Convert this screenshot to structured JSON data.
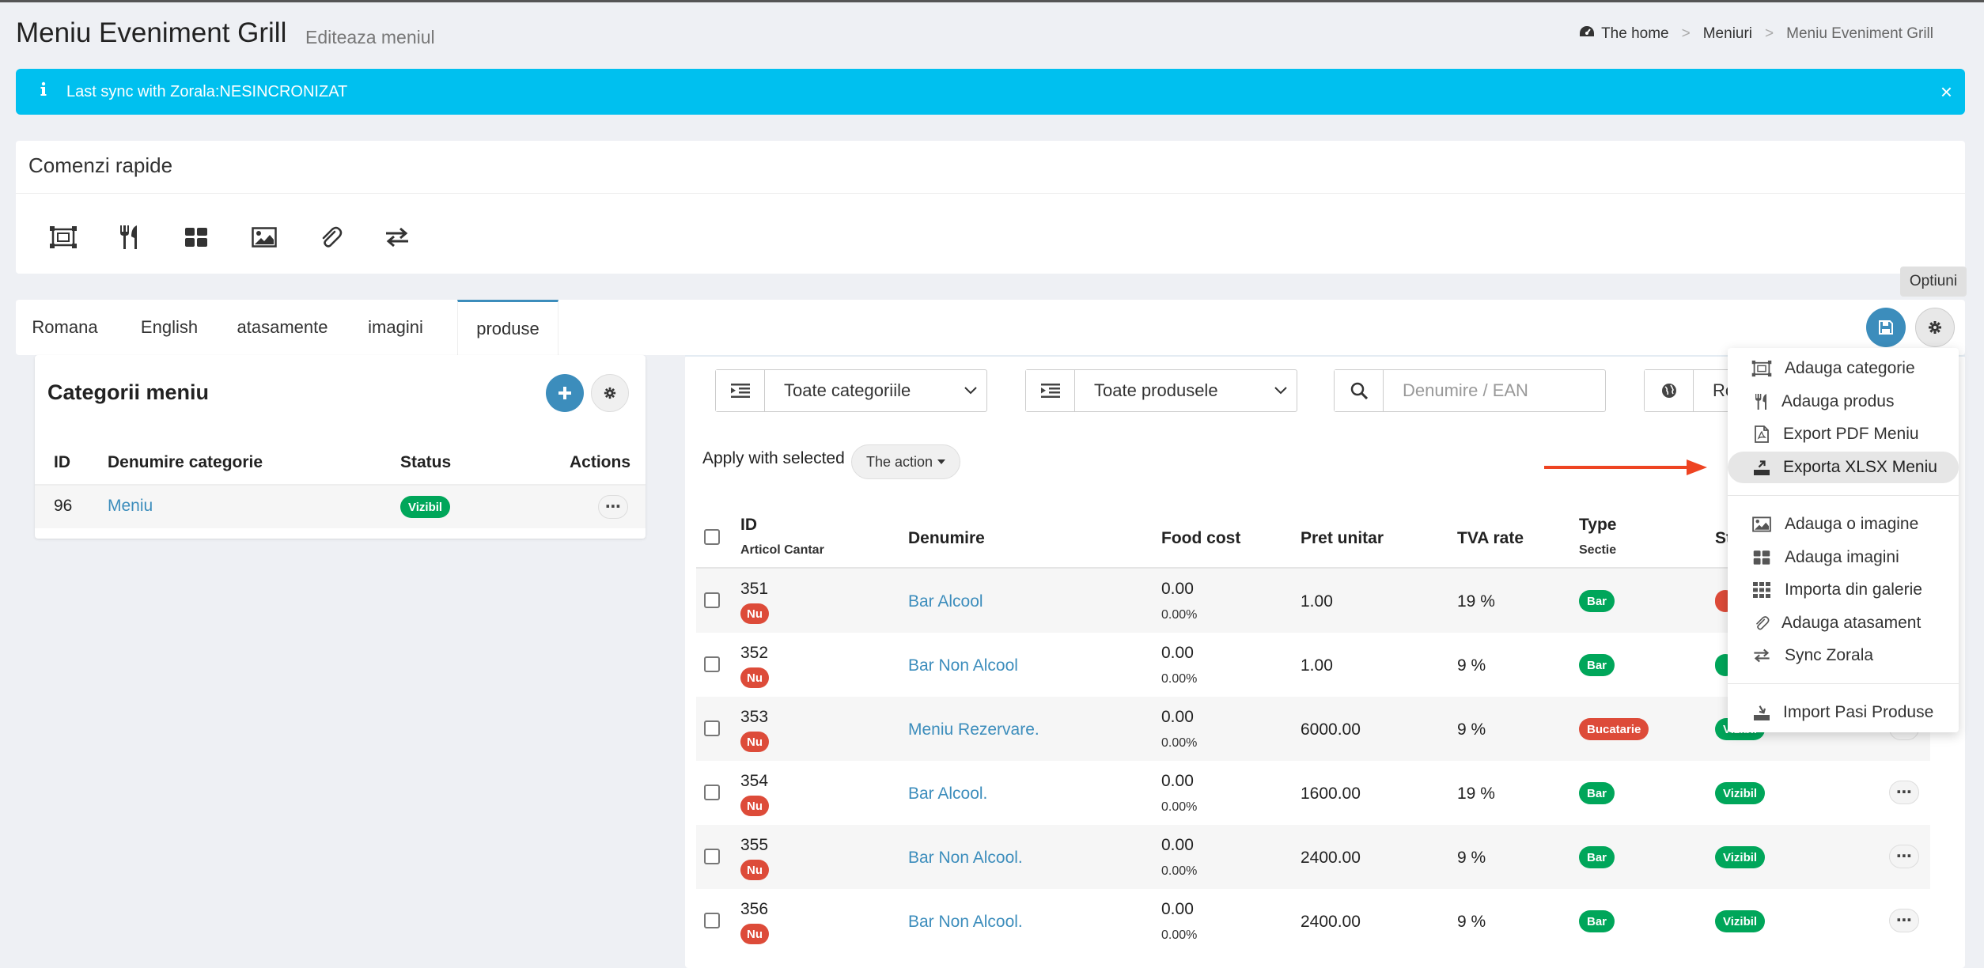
{
  "header": {
    "title": "Meniu Eveniment Grill",
    "subtitle": "Editeaza meniul",
    "breadcrumb": {
      "home": "The home",
      "sep": ">",
      "level2": "Meniuri",
      "current": "Meniu Eveniment Grill"
    }
  },
  "alert": {
    "icon": "info-icon",
    "text": "Last sync with Zorala:NESINCRONIZAT",
    "close": "×",
    "color": "#00c0ef"
  },
  "quick": {
    "title": "Comenzi rapide",
    "icons": [
      "add-category-icon",
      "cutlery-icon",
      "grid-icon",
      "image-icon",
      "paperclip-icon",
      "sync-arrows-icon"
    ]
  },
  "tabs": [
    {
      "label": "Romana"
    },
    {
      "label": "English"
    },
    {
      "label": "atasamente"
    },
    {
      "label": "imagini"
    },
    {
      "label": "produse",
      "active": true
    }
  ],
  "options_tooltip": "Optiuni",
  "categories": {
    "title": "Categorii meniu",
    "headers": {
      "id": "ID",
      "name": "Denumire categorie",
      "status": "Status",
      "actions": "Actions"
    },
    "rows": [
      {
        "id": "96",
        "name": "Meniu",
        "status": "Vizibil"
      }
    ]
  },
  "filters": {
    "category": "Toate categoriile",
    "products": "Toate produsele",
    "search_placeholder": "Denumire / EAN",
    "language": "Ro"
  },
  "bulk": {
    "label": "Apply with selected",
    "action": "The action"
  },
  "products": {
    "headers": {
      "id": "ID",
      "id_sub": "Articol Cantar",
      "name": "Denumire",
      "food_cost": "Food cost",
      "price": "Pret unitar",
      "tva": "TVA rate",
      "type": "Type",
      "type_sub": "Sectie",
      "status": "St"
    },
    "rows": [
      {
        "id": "351",
        "scale": "Nu",
        "name": "Bar Alcool",
        "cost": "0.00",
        "cost_pct": "0.00%",
        "price": "1.00",
        "tva": "19 %",
        "type": "Bar",
        "status": ""
      },
      {
        "id": "352",
        "scale": "Nu",
        "name": "Bar Non Alcool",
        "cost": "0.00",
        "cost_pct": "0.00%",
        "price": "1.00",
        "tva": "9 %",
        "type": "Bar",
        "status": ""
      },
      {
        "id": "353",
        "scale": "Nu",
        "name": "Meniu Rezervare.",
        "cost": "0.00",
        "cost_pct": "0.00%",
        "price": "6000.00",
        "tva": "9 %",
        "type": "Bucatarie",
        "status": "Vizibil"
      },
      {
        "id": "354",
        "scale": "Nu",
        "name": "Bar Alcool.",
        "cost": "0.00",
        "cost_pct": "0.00%",
        "price": "1600.00",
        "tva": "19 %",
        "type": "Bar",
        "status": "Vizibil"
      },
      {
        "id": "355",
        "scale": "Nu",
        "name": "Bar Non Alcool.",
        "cost": "0.00",
        "cost_pct": "0.00%",
        "price": "2400.00",
        "tva": "9 %",
        "type": "Bar",
        "status": "Vizibil"
      },
      {
        "id": "356",
        "scale": "Nu",
        "name": "Bar Non Alcool.",
        "cost": "0.00",
        "cost_pct": "0.00%",
        "price": "2400.00",
        "tva": "9 %",
        "type": "Bar",
        "status": "Vizibil"
      }
    ]
  },
  "menu": {
    "items": [
      {
        "label": "Adauga categorie",
        "icon": "add-category-icon"
      },
      {
        "label": "Adauga produs",
        "icon": "cutlery-icon"
      },
      {
        "label": "Export PDF Meniu",
        "icon": "pdf-file-icon"
      },
      {
        "label": "Exporta XLSX Meniu",
        "icon": "export-icon",
        "highlighted": true
      },
      {
        "label": "Adauga o imagine",
        "icon": "image-icon"
      },
      {
        "label": "Adauga imagini",
        "icon": "grid-icon"
      },
      {
        "label": "Importa din galerie",
        "icon": "grid-9-icon"
      },
      {
        "label": "Adauga atasament",
        "icon": "paperclip-icon"
      },
      {
        "label": "Sync Zorala",
        "icon": "sync-arrows-icon"
      },
      {
        "label": "Import Pasi Produse",
        "icon": "import-icon"
      }
    ]
  },
  "colors": {
    "primary": "#3c8dbc",
    "success": "#00a65a",
    "danger": "#dd4b39",
    "info": "#00c0ef",
    "arrow": "#ee4422"
  }
}
